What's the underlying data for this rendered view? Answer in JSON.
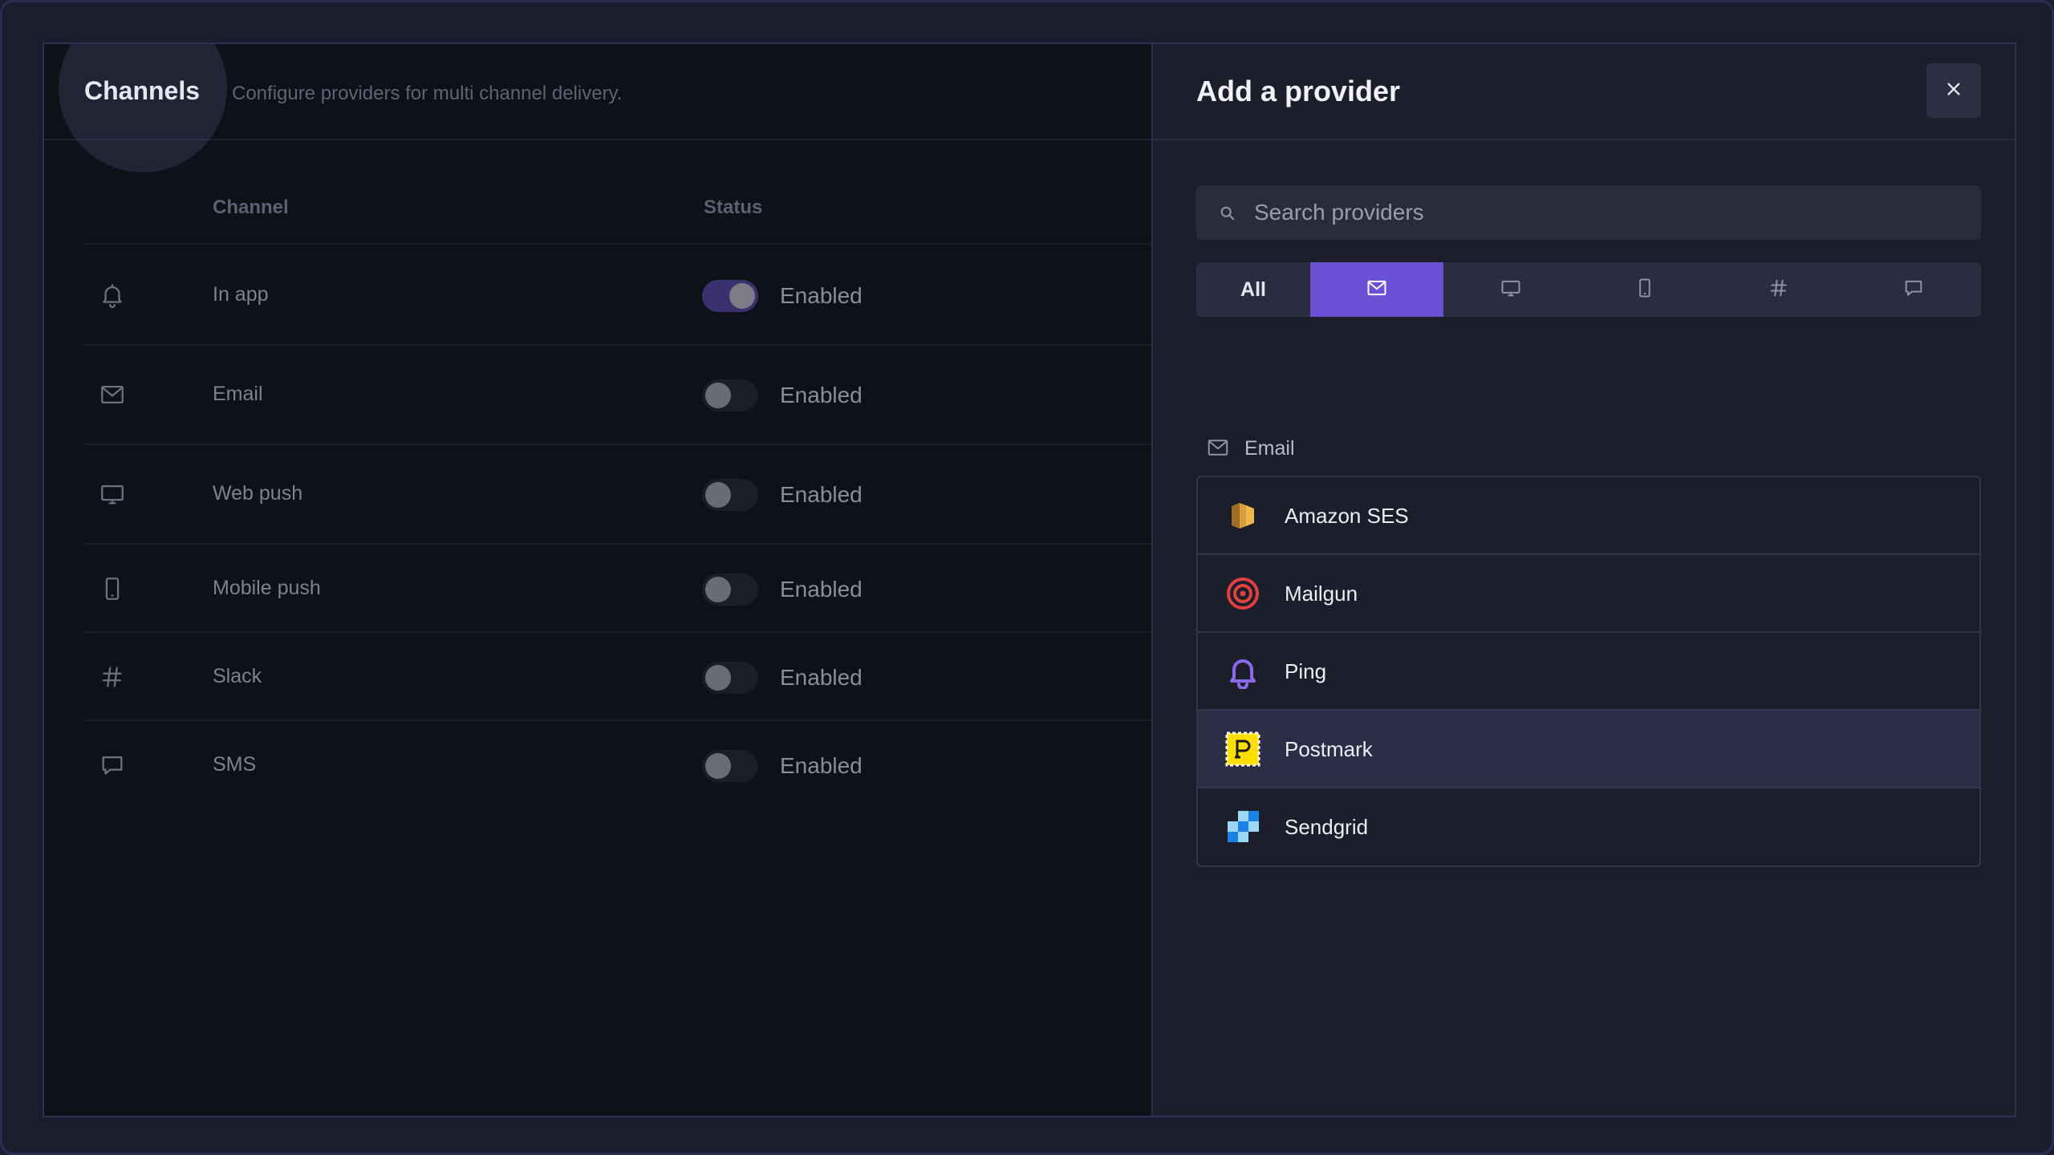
{
  "left": {
    "title": "Channels",
    "subtitle": "Configure providers for multi channel delivery.",
    "columns": {
      "channel": "Channel",
      "status": "Status"
    },
    "rows": [
      {
        "icon": "bell-icon",
        "label": "In app",
        "status": "Enabled",
        "on": true
      },
      {
        "icon": "mail-icon",
        "label": "Email",
        "status": "Enabled",
        "on": false
      },
      {
        "icon": "monitor-icon",
        "label": "Web push",
        "status": "Enabled",
        "on": false
      },
      {
        "icon": "mobile-icon",
        "label": "Mobile push",
        "status": "Enabled",
        "on": false
      },
      {
        "icon": "hash-icon",
        "label": "Slack",
        "status": "Enabled",
        "on": false
      },
      {
        "icon": "chat-icon",
        "label": "SMS",
        "status": "Enabled",
        "on": false
      }
    ]
  },
  "right": {
    "title": "Add a provider",
    "search": {
      "placeholder": "Search providers",
      "value": ""
    },
    "tabs": [
      {
        "label": "All",
        "icon": ""
      },
      {
        "label": "",
        "icon": "mail-icon",
        "active": true
      },
      {
        "label": "",
        "icon": "monitor-icon"
      },
      {
        "label": "",
        "icon": "mobile-icon"
      },
      {
        "label": "",
        "icon": "hash-icon"
      },
      {
        "label": "",
        "icon": "chat-icon"
      }
    ],
    "section": {
      "icon": "mail-icon",
      "label": "Email"
    },
    "providers": [
      {
        "name": "Amazon SES",
        "logo": "amazon-ses-logo"
      },
      {
        "name": "Mailgun",
        "logo": "mailgun-logo"
      },
      {
        "name": "Ping",
        "logo": "ping-logo"
      },
      {
        "name": "Postmark",
        "logo": "postmark-logo",
        "highlighted": true
      },
      {
        "name": "Sendgrid",
        "logo": "sendgrid-logo"
      }
    ]
  },
  "colors": {
    "accent": "#6a51d6",
    "toggle_on": "#3a3270",
    "panel_bg": "#1c1e2c",
    "page_bg": "#0f1118"
  }
}
